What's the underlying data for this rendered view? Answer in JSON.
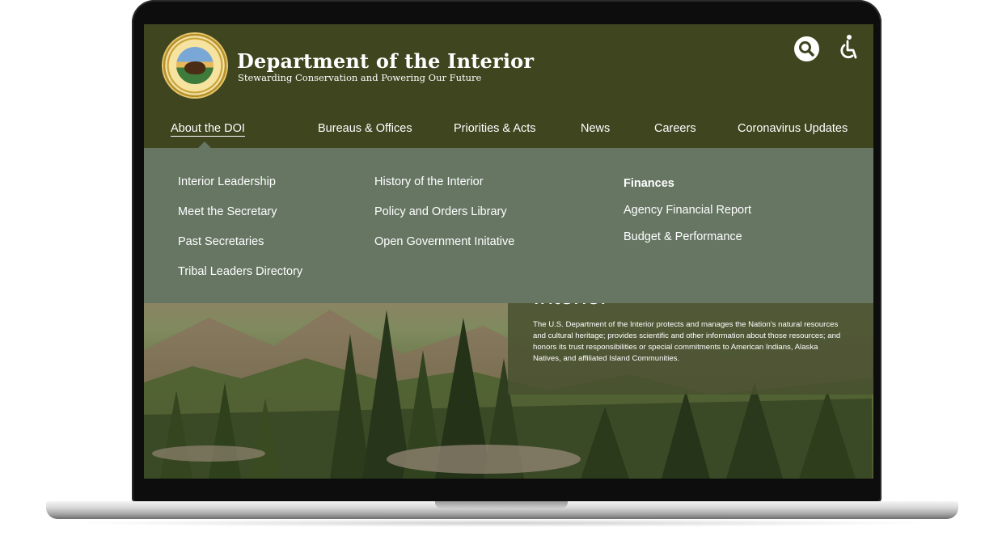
{
  "site": {
    "title": "Department of the Interior",
    "subtitle": "Stewarding Conservation and Powering Our Future"
  },
  "icons": {
    "search": "search-icon",
    "accessibility": "accessibility-icon"
  },
  "nav": {
    "items": [
      {
        "label": "About the DOI",
        "active": true
      },
      {
        "label": "Bureaus & Offices"
      },
      {
        "label": "Priorities & Acts"
      },
      {
        "label": "News"
      },
      {
        "label": "Careers"
      },
      {
        "label": "Coronavirus Updates"
      }
    ]
  },
  "dropdown": {
    "col1": [
      "Interior Leadership",
      "Meet the Secretary",
      "Past Secretaries",
      "Tribal Leaders Directory"
    ],
    "col2": [
      "History of the Interior",
      "Policy and Orders Library",
      "Open Government Initative"
    ],
    "col3_heading": "Finances",
    "col3": [
      "Agency Financial Report",
      "Budget & Performance"
    ]
  },
  "hero": {
    "heading": "Interior",
    "text": "The U.S. Department of the Interior protects and manages the Nation's natural resources and cultural heritage; provides scientific and other information about those resources; and honors its trust responsibilities or special commitments to American Indians, Alaska Natives, and affiliated Island Communities."
  },
  "colors": {
    "header_bg": "#3e451f",
    "dropdown_bg": "#667663",
    "text": "#ffffff"
  }
}
